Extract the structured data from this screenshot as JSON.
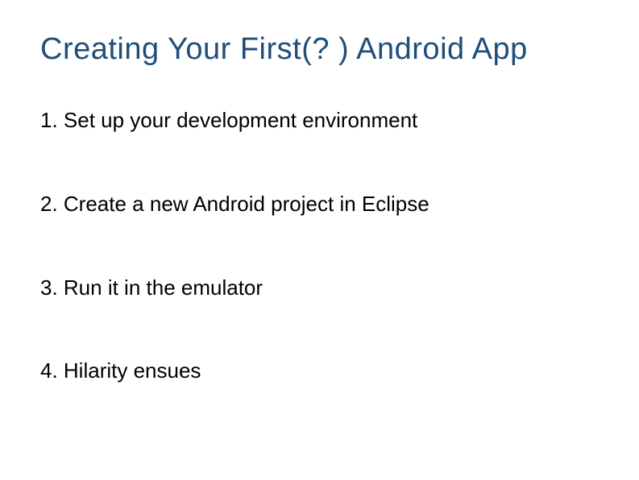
{
  "title": "Creating Your First(? ) Android App",
  "items": [
    "1. Set up your development environment",
    "2. Create a new Android project in Eclipse",
    "3. Run it in the emulator",
    "4. Hilarity ensues"
  ]
}
